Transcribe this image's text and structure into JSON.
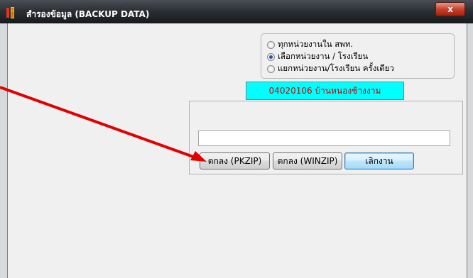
{
  "window": {
    "title": "สำรองข้อมูล (BACKUP DATA)",
    "close_label": "x"
  },
  "options": [
    {
      "label": "ทุกหน่วยงานใน สพท.",
      "selected": false
    },
    {
      "label": "เลือกหน่วยงาน / โรงเรียน",
      "selected": true
    },
    {
      "label": "แยกหน่วยงาน/โรงเรียน ครั้งเดียว",
      "selected": false
    }
  ],
  "selected_school": "04020106  บ้านหนองช้างงาม",
  "path_input": {
    "value": ""
  },
  "buttons": {
    "pkzip": "ตกลง (PKZIP)",
    "winzip": "ตกลง (WINZIP)",
    "cancel": "เลิกงาน"
  },
  "colors": {
    "annotation_arrow": "#e00000",
    "school_box_bg": "#00ffff",
    "school_box_text": "#c00000"
  }
}
